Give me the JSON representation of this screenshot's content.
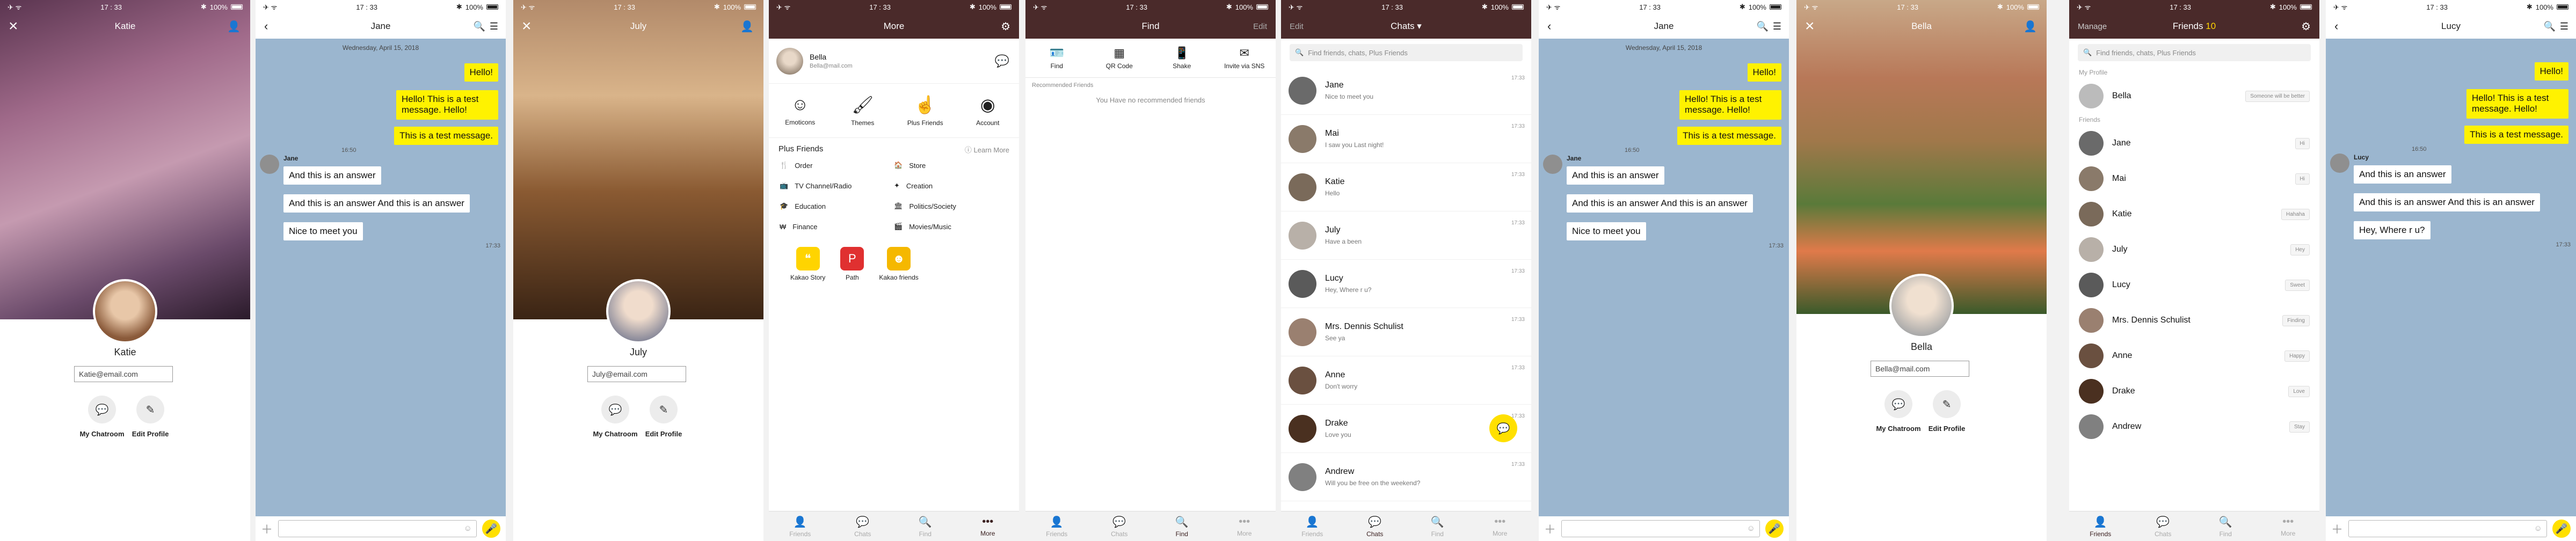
{
  "status": {
    "time": "17 : 33",
    "battery": "100%"
  },
  "profile_katie": {
    "name": "Katie",
    "email": "Katie@email.com",
    "chatroom": "My Chatroom",
    "edit": "Edit Profile"
  },
  "chat_jane": {
    "title": "Jane",
    "date": "Wednesday, April 15, 2018",
    "mine": [
      "Hello!",
      "Hello! This is a test message. Hello!",
      "This is a test message."
    ],
    "time1": "16:50",
    "sender": "Jane",
    "theirs": [
      "And this is an answer",
      "And this is an answer And this is an answer",
      "Nice to meet you"
    ],
    "time2": "17:33"
  },
  "profile_july": {
    "name": "July",
    "email": "July@email.com",
    "chatroom": "My Chatroom",
    "edit": "Edit Profile"
  },
  "more": {
    "title": "More",
    "user": "Bella",
    "user_email": "Bella@mail.com",
    "grid": [
      "Emoticons",
      "Themes",
      "Plus Friends",
      "Account"
    ],
    "plus_title": "Plus Friends",
    "learn_more": "Learn More",
    "plus": [
      "Order",
      "Store",
      "TV Channel/Radio",
      "Creation",
      "Education",
      "Politics/Society",
      "Finance",
      "Movies/Music"
    ],
    "apps": [
      "Kakao Story",
      "Path",
      "Kakao friends"
    ]
  },
  "find": {
    "title": "Find",
    "edit": "Edit",
    "tools": [
      "Find",
      "QR Code",
      "Shake",
      "Invite via SNS"
    ],
    "rec_label": "Recommended Friends",
    "empty": "You Have no recommended friends"
  },
  "chats": {
    "edit": "Edit",
    "title": "Chats ▾",
    "search": "Find friends, chats, Plus Friends",
    "items": [
      {
        "name": "Jane",
        "msg": "Nice to meet you",
        "time": "17:33"
      },
      {
        "name": "Mai",
        "msg": "I saw you Last night!",
        "time": "17:33"
      },
      {
        "name": "Katie",
        "msg": "Hello",
        "time": "17:33"
      },
      {
        "name": "July",
        "msg": "Have a been",
        "time": "17:33"
      },
      {
        "name": "Lucy",
        "msg": "Hey, Where r u?",
        "time": "17:33"
      },
      {
        "name": "Mrs. Dennis Schulist",
        "msg": "See ya",
        "time": "17:33"
      },
      {
        "name": "Anne",
        "msg": "Don't worry",
        "time": "17:33"
      },
      {
        "name": "Drake",
        "msg": "Love you",
        "time": "17:33"
      },
      {
        "name": "Andrew",
        "msg": "Will you be free on the weekend?",
        "time": "17:33"
      }
    ]
  },
  "chat_jane2": {
    "title": "Jane",
    "date": "Wednesday, April 15, 2018",
    "mine": [
      "Hello!",
      "Hello! This is a test message. Hello!",
      "This is a test message."
    ],
    "time1": "16:50",
    "sender": "Jane",
    "theirs": [
      "And this is an answer",
      "And this is an answer And this is an answer",
      "Nice to meet you"
    ],
    "time2": "17:33"
  },
  "profile_bella": {
    "name": "Bella",
    "email": "Bella@mail.com",
    "chatroom": "My Chatroom",
    "edit": "Edit Profile"
  },
  "friends": {
    "manage": "Manage",
    "title": "Friends",
    "count": "10",
    "search": "Find friends, chats, Plus Friends",
    "my_profile": "My Profile",
    "me": "Bella",
    "me_status": "Someone will be better",
    "friends_label": "Friends",
    "items": [
      {
        "name": "Jane",
        "status": "Hi"
      },
      {
        "name": "Mai",
        "status": "Hi"
      },
      {
        "name": "Katie",
        "status": "Hahaha"
      },
      {
        "name": "July",
        "status": "Hey"
      },
      {
        "name": "Lucy",
        "status": "Sweet"
      },
      {
        "name": "Mrs. Dennis Schulist",
        "status": "Finding"
      },
      {
        "name": "Anne",
        "status": "Happy"
      },
      {
        "name": "Drake",
        "status": "Love"
      },
      {
        "name": "Andrew",
        "status": "Stay"
      }
    ]
  },
  "chat_lucy": {
    "title": "Lucy",
    "mine": [
      "Hello!",
      "Hello! This is a test message. Hello!",
      "This is a test message."
    ],
    "time1": "16:50",
    "sender": "Lucy",
    "theirs": [
      "And this is an answer",
      "And this is an answer And this is an answer",
      "Hey, Where r u?"
    ],
    "time2": "17:33"
  },
  "tabs": [
    "Friends",
    "Chats",
    "Find",
    "More"
  ],
  "colors": {
    "brown": "#4a2a2a",
    "yellow": "#fff200",
    "chat_bg": "#9bb6cf"
  }
}
